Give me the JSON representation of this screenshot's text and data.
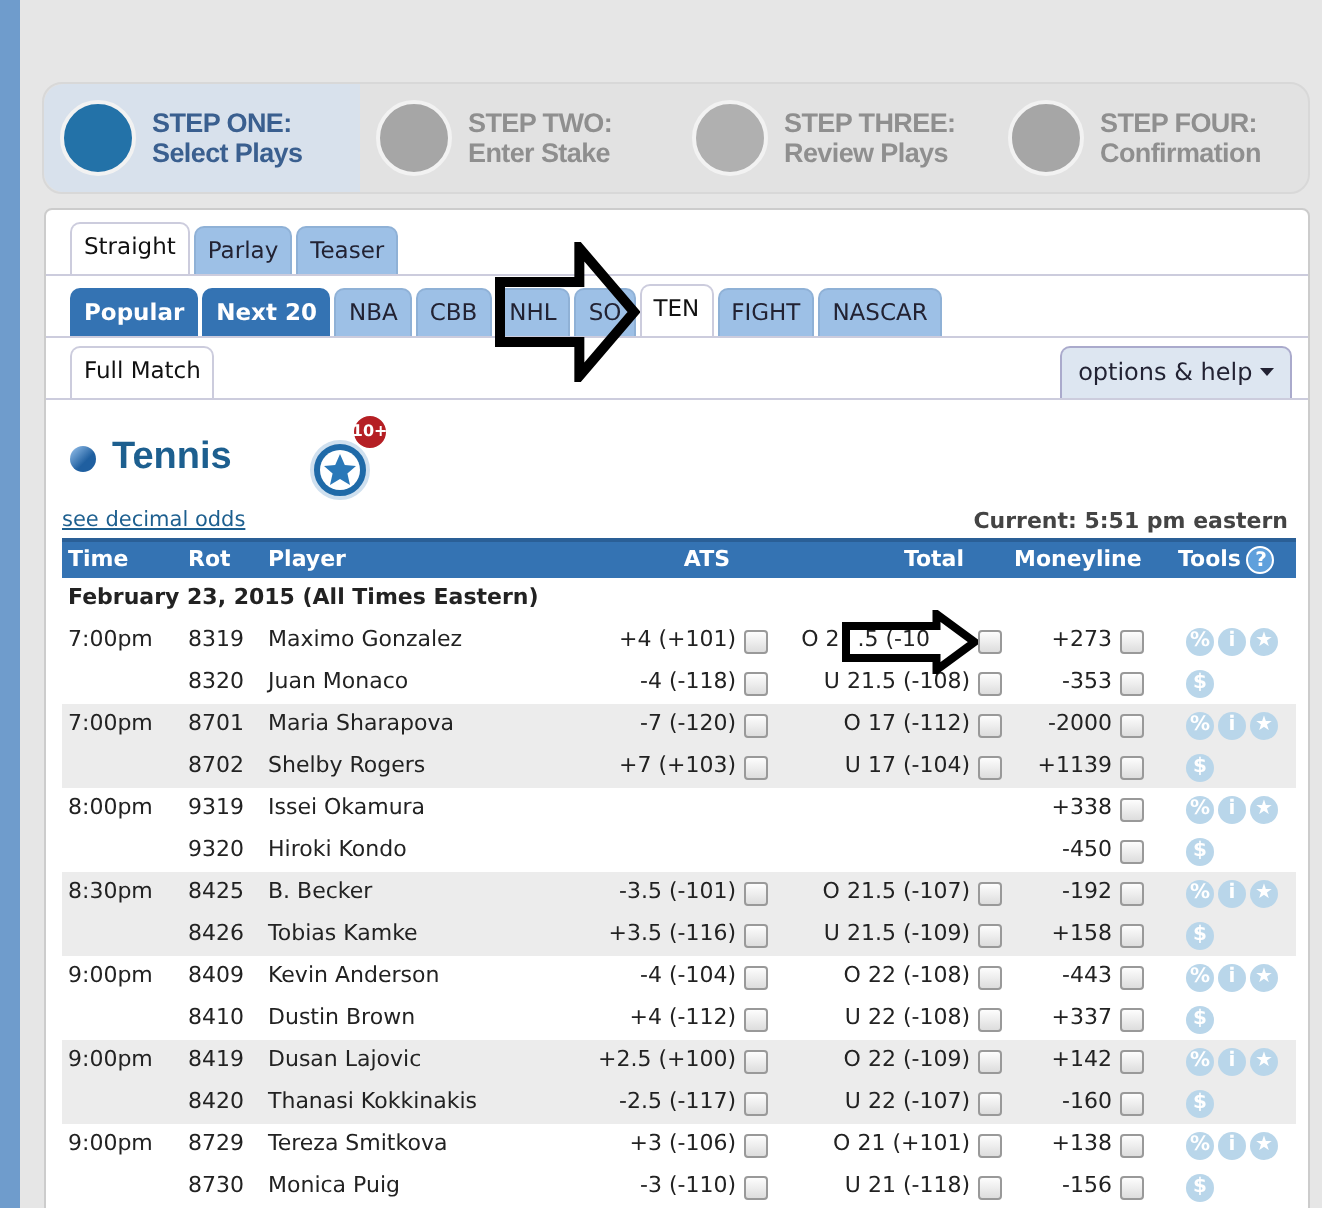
{
  "steps": [
    {
      "title": "STEP ONE:",
      "subtitle": "Select Plays",
      "selected": true
    },
    {
      "title": "STEP TWO:",
      "subtitle": "Enter Stake",
      "selected": false
    },
    {
      "title": "STEP THREE:",
      "subtitle": "Review Plays",
      "selected": false
    },
    {
      "title": "STEP FOUR:",
      "subtitle": "Confirmation",
      "selected": false
    }
  ],
  "bet_tabs": [
    {
      "label": "Straight",
      "selected": true
    },
    {
      "label": "Parlay",
      "selected": false
    },
    {
      "label": "Teaser",
      "selected": false
    }
  ],
  "sport_tabs": [
    {
      "label": "Popular",
      "kind": "featured",
      "selected": false
    },
    {
      "label": "Next 20",
      "kind": "featured",
      "selected": false
    },
    {
      "label": "NBA",
      "kind": "sport",
      "selected": false
    },
    {
      "label": "CBB",
      "kind": "sport",
      "selected": false
    },
    {
      "label": "NHL",
      "kind": "sport",
      "selected": false
    },
    {
      "label": "SO",
      "kind": "sport",
      "selected": false
    },
    {
      "label": "TEN",
      "kind": "sport",
      "selected": true
    },
    {
      "label": "FIGHT",
      "kind": "sport",
      "selected": false
    },
    {
      "label": "NASCAR",
      "kind": "sport",
      "selected": false
    }
  ],
  "period_tabs": [
    {
      "label": "Full Match",
      "selected": true
    }
  ],
  "options_button": "options & help",
  "heading": "Tennis",
  "favorites_badge": "10+",
  "decimal_link": "see decimal odds",
  "current_time": "Current: 5:51 pm eastern",
  "table": {
    "columns": [
      "Time",
      "Rot",
      "Player",
      "ATS",
      "Total",
      "Moneyline",
      "Tools"
    ],
    "help_icon": "?",
    "date": "February 23, 2015 (All Times Eastern)",
    "games": [
      {
        "time": "7:00pm",
        "tools": [
          "%",
          "i",
          "★",
          "$"
        ],
        "players": [
          {
            "rot": "8319",
            "name": "Maximo Gonzalez",
            "ats": {
              "text": "+4 (+101)",
              "checked": false
            },
            "total": {
              "text": "O 2",
              "text_after": ".5 (-10",
              "checked": false
            },
            "moneyline": {
              "text": "+273",
              "checked": false
            }
          },
          {
            "rot": "8320",
            "name": "Juan Monaco",
            "ats": {
              "text": "-4 (-118)",
              "checked": false
            },
            "total": {
              "text": "U 21.5 (-108)",
              "checked": false
            },
            "moneyline": {
              "text": "-353",
              "checked": false
            }
          }
        ]
      },
      {
        "time": "7:00pm",
        "tools": [
          "%",
          "i",
          "★",
          "$"
        ],
        "players": [
          {
            "rot": "8701",
            "name": "Maria Sharapova",
            "ats": {
              "text": "-7 (-120)",
              "checked": false
            },
            "total": {
              "text": "O 17 (-112)",
              "checked": false
            },
            "moneyline": {
              "text": "-2000",
              "checked": false
            }
          },
          {
            "rot": "8702",
            "name": "Shelby Rogers",
            "ats": {
              "text": "+7 (+103)",
              "checked": false
            },
            "total": {
              "text": "U 17 (-104)",
              "checked": false
            },
            "moneyline": {
              "text": "+1139",
              "checked": false
            }
          }
        ]
      },
      {
        "time": "8:00pm",
        "tools": [
          "%",
          "i",
          "★",
          "$"
        ],
        "players": [
          {
            "rot": "9319",
            "name": "Issei Okamura",
            "moneyline": {
              "text": "+338",
              "checked": false
            }
          },
          {
            "rot": "9320",
            "name": "Hiroki Kondo",
            "moneyline": {
              "text": "-450",
              "checked": false
            }
          }
        ]
      },
      {
        "time": "8:30pm",
        "tools": [
          "%",
          "i",
          "★",
          "$"
        ],
        "players": [
          {
            "rot": "8425",
            "name": "B. Becker",
            "ats": {
              "text": "-3.5 (-101)",
              "checked": false
            },
            "total": {
              "text": "O 21.5 (-107)",
              "checked": false
            },
            "moneyline": {
              "text": "-192",
              "checked": false
            }
          },
          {
            "rot": "8426",
            "name": "Tobias Kamke",
            "ats": {
              "text": "+3.5 (-116)",
              "checked": false
            },
            "total": {
              "text": "U 21.5 (-109)",
              "checked": false
            },
            "moneyline": {
              "text": "+158",
              "checked": false
            }
          }
        ]
      },
      {
        "time": "9:00pm",
        "tools": [
          "%",
          "i",
          "★",
          "$"
        ],
        "players": [
          {
            "rot": "8409",
            "name": "Kevin Anderson",
            "ats": {
              "text": "-4 (-104)",
              "checked": false
            },
            "total": {
              "text": "O 22 (-108)",
              "checked": false
            },
            "moneyline": {
              "text": "-443",
              "checked": false
            }
          },
          {
            "rot": "8410",
            "name": "Dustin Brown",
            "ats": {
              "text": "+4 (-112)",
              "checked": false
            },
            "total": {
              "text": "U 22 (-108)",
              "checked": false
            },
            "moneyline": {
              "text": "+337",
              "checked": false
            }
          }
        ]
      },
      {
        "time": "9:00pm",
        "tools": [
          "%",
          "i",
          "★",
          "$"
        ],
        "players": [
          {
            "rot": "8419",
            "name": "Dusan Lajovic",
            "ats": {
              "text": "+2.5 (+100)",
              "checked": false
            },
            "total": {
              "text": "O 22 (-109)",
              "checked": false
            },
            "moneyline": {
              "text": "+142",
              "checked": false
            }
          },
          {
            "rot": "8420",
            "name": "Thanasi Kokkinakis",
            "ats": {
              "text": "-2.5 (-117)",
              "checked": false
            },
            "total": {
              "text": "U 22 (-107)",
              "checked": false
            },
            "moneyline": {
              "text": "-160",
              "checked": false
            }
          }
        ]
      },
      {
        "time": "9:00pm",
        "tools": [
          "%",
          "i",
          "★",
          "$"
        ],
        "players": [
          {
            "rot": "8729",
            "name": "Tereza Smitkova",
            "ats": {
              "text": "+3 (-106)",
              "checked": false
            },
            "total": {
              "text": "O 21 (+101)",
              "checked": false
            },
            "moneyline": {
              "text": "+138",
              "checked": false
            }
          },
          {
            "rot": "8730",
            "name": "Monica Puig",
            "ats": {
              "text": "-3 (-110)",
              "checked": false
            },
            "total": {
              "text": "U 21 (-118)",
              "checked": false
            },
            "moneyline": {
              "text": "-156",
              "checked": false
            }
          }
        ]
      }
    ]
  }
}
